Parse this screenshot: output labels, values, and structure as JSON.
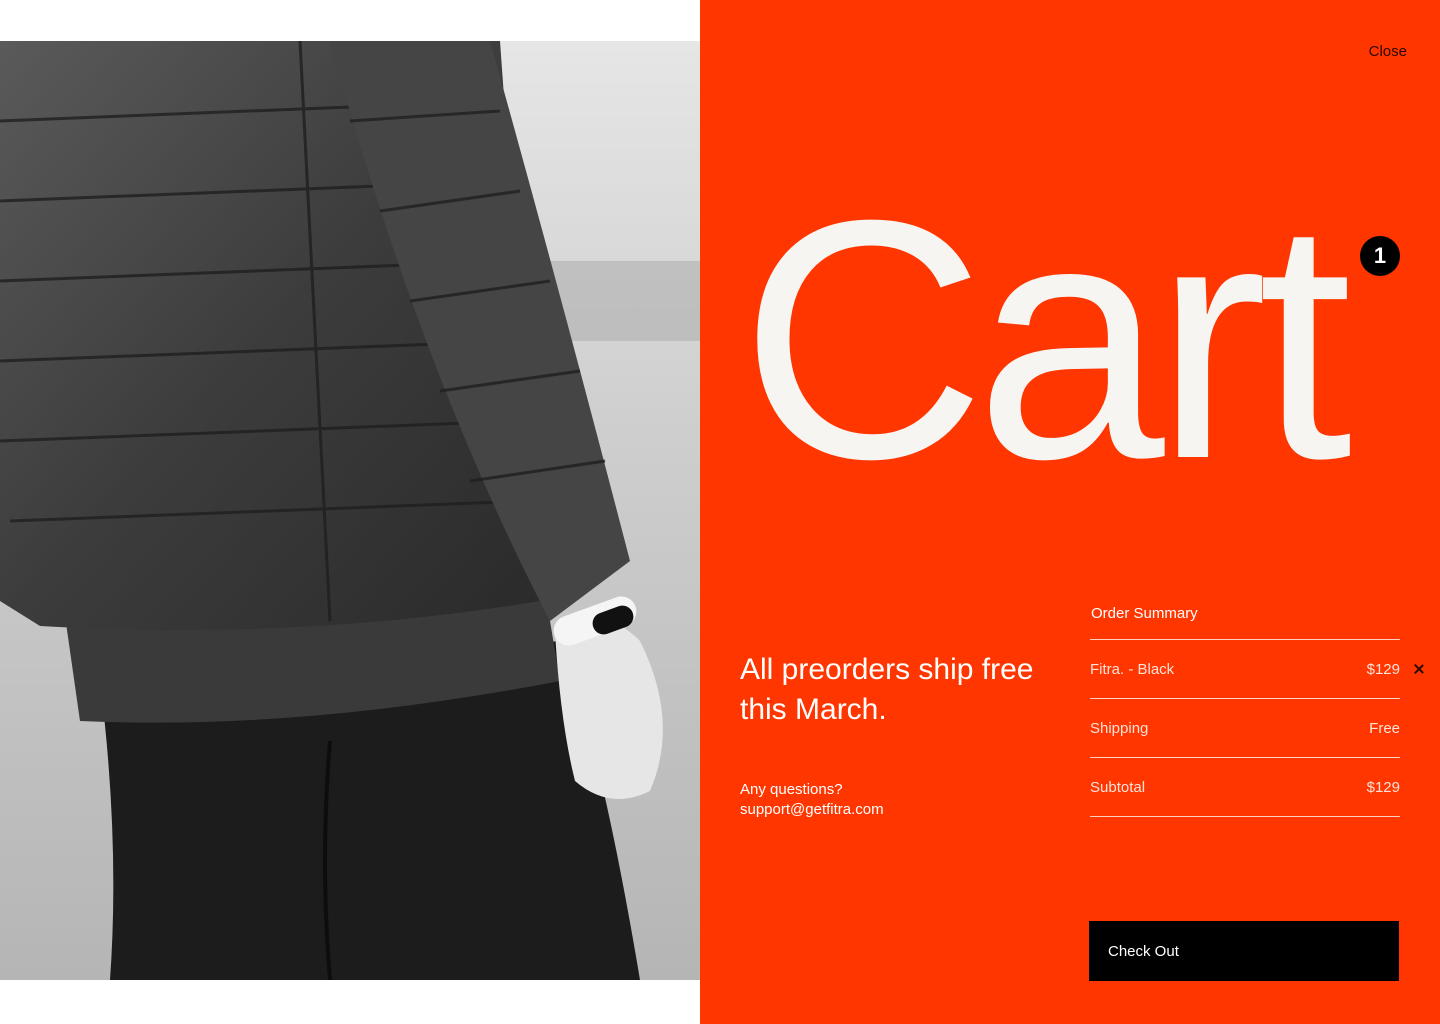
{
  "panel": {
    "background_color": "#ff3600",
    "close_label": "Close",
    "title": "Cart",
    "item_count": "1"
  },
  "promo": {
    "headline": "All preorders ship free this March.",
    "questions_label": "Any questions?",
    "support_email": "support@getfitra.com"
  },
  "order_summary": {
    "heading": "Order Summary",
    "rows": [
      {
        "label": "Fitra. - Black",
        "value": "$129"
      },
      {
        "label": "Shipping",
        "value": "Free"
      },
      {
        "label": "Subtotal",
        "value": "$129"
      }
    ]
  },
  "checkout": {
    "label": "Check Out"
  },
  "photo": {
    "icon": "product-photo"
  }
}
